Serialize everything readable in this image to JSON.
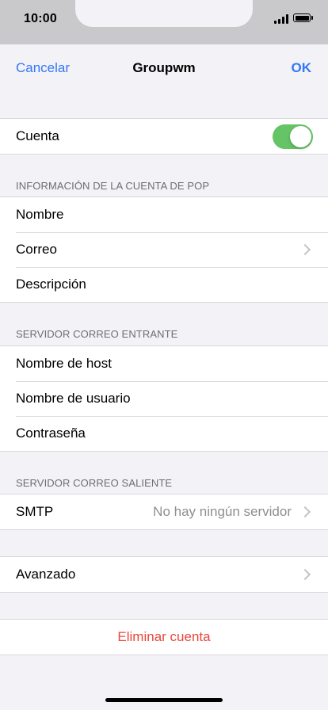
{
  "status_bar": {
    "time": "10:00",
    "icons": [
      "signal-icon",
      "battery-icon"
    ]
  },
  "nav": {
    "cancel_label": "Cancelar",
    "title": "Groupwm",
    "ok_label": "OK"
  },
  "account": {
    "label": "Cuenta",
    "toggle_on": true
  },
  "pop_section": {
    "header": "INFORMACIÓN DE LA CUENTA DE POP",
    "items": [
      {
        "label": "Nombre"
      },
      {
        "label": "Correo"
      },
      {
        "label": "Descripción"
      }
    ]
  },
  "incoming_section": {
    "header": "SERVIDOR CORREO ENTRANTE",
    "items": [
      {
        "label": "Nombre de host"
      },
      {
        "label": "Nombre de usuario"
      },
      {
        "label": "Contraseña"
      }
    ]
  },
  "outgoing_section": {
    "header": "SERVIDOR CORREO SALIENTE",
    "smtp_label": "SMTP",
    "smtp_value": "No hay ningún servidor"
  },
  "advanced": {
    "label": "Avanzado"
  },
  "delete": {
    "label": "Eliminar cuenta"
  },
  "colors": {
    "accent": "#3478f6",
    "toggle_on": "#65c466",
    "destructive": "#e8473b",
    "secondary_text": "#8e8e93"
  }
}
